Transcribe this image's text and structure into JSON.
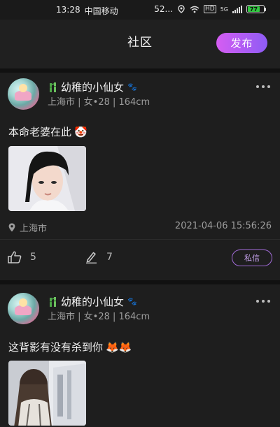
{
  "status_bar": {
    "time": "13:28",
    "carrier": "中国移动",
    "speed": "52...",
    "hd_label": "HD",
    "network_label": "5G",
    "battery": "77",
    "battery_level": 0.77,
    "battery_color": "#31c840"
  },
  "header": {
    "title": "社区",
    "publish_label": "发布",
    "publish_gradient": [
      "#d55df2",
      "#8e5cf5"
    ]
  },
  "posts": [
    {
      "username": "幼稚的小仙女",
      "meta": "上海市 | 女•28 | 164cm",
      "text": "本命老婆在此",
      "text_emoji": "🤡",
      "location": "上海市",
      "time": "2021-04-06 15:56:26",
      "likes": "5",
      "comments": "7",
      "dm_label": "私信"
    },
    {
      "username": "幼稚的小仙女",
      "meta": "上海市 | 女•28 | 164cm",
      "text": "这背影有没有杀到你",
      "text_emoji": "🦊🦊"
    }
  ],
  "icons": {
    "location": "location-pin-icon",
    "like": "thumbs-up-icon",
    "comment": "pencil-icon",
    "more": "more-dots-icon",
    "badge": "bamboo-badge-icon",
    "paw": "paw-icon"
  }
}
